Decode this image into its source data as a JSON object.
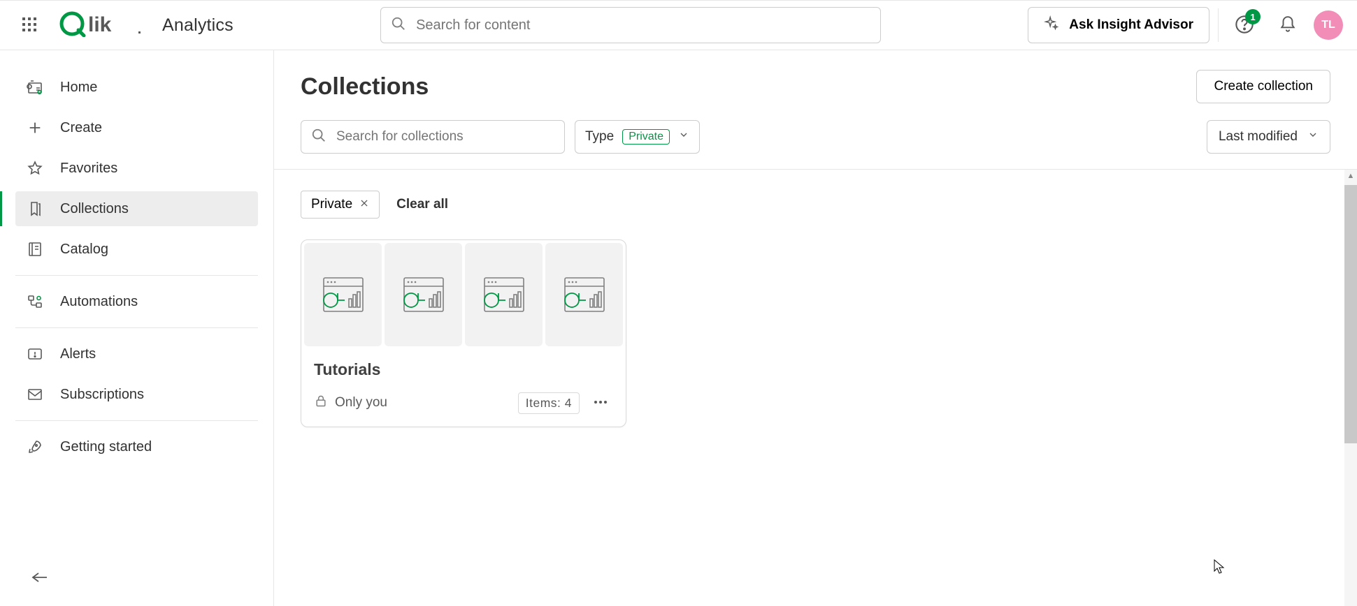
{
  "header": {
    "search_placeholder": "Search for content",
    "app_title": "Analytics",
    "ask_label": "Ask Insight Advisor",
    "notif_badge": "1",
    "avatar_initials": "TL"
  },
  "sidebar": {
    "items": [
      {
        "label": "Home"
      },
      {
        "label": "Create"
      },
      {
        "label": "Favorites"
      },
      {
        "label": "Collections"
      },
      {
        "label": "Catalog"
      },
      {
        "label": "Automations"
      },
      {
        "label": "Alerts"
      },
      {
        "label": "Subscriptions"
      },
      {
        "label": "Getting started"
      }
    ]
  },
  "page": {
    "title": "Collections",
    "create_button": "Create collection",
    "search_placeholder": "Search for collections",
    "type_label": "Type",
    "type_value": "Private",
    "sort_label": "Last modified",
    "chip_label": "Private",
    "clear_all": "Clear all"
  },
  "cards": [
    {
      "title": "Tutorials",
      "visibility": "Only you",
      "count_label": "Items: 4"
    }
  ]
}
